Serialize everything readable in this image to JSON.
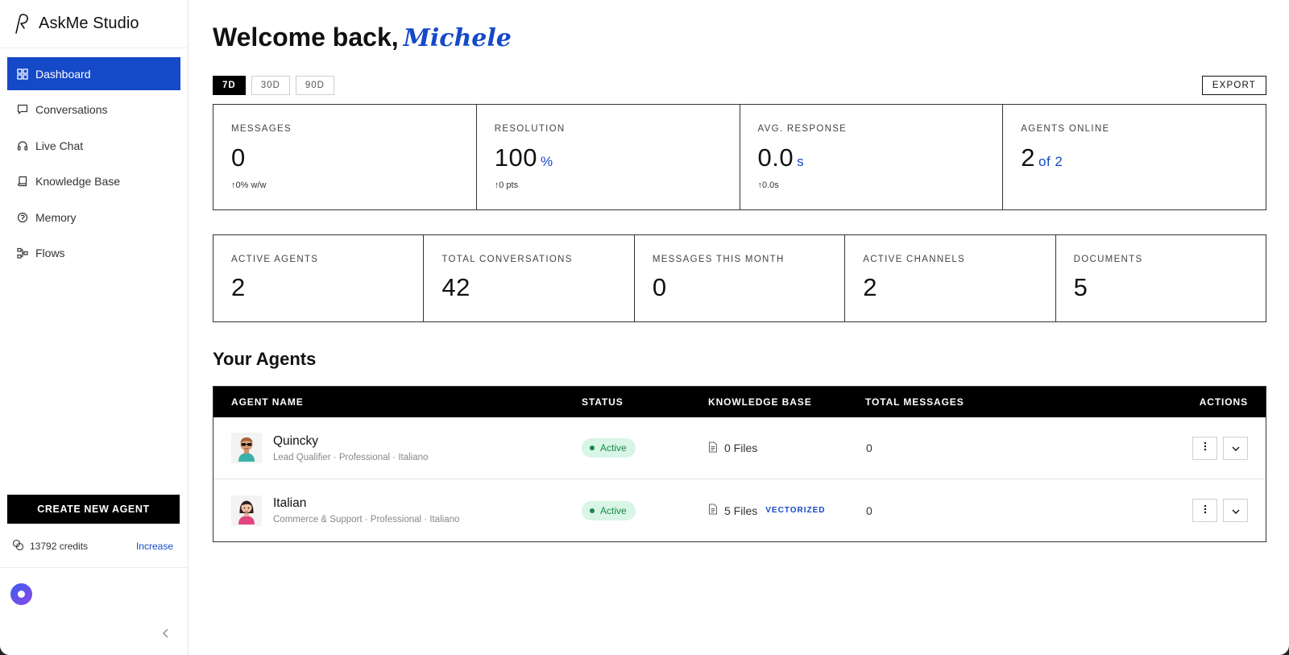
{
  "app": {
    "name": "AskMe Studio"
  },
  "sidebar": {
    "items": [
      {
        "label": "Dashboard",
        "icon": "grid-icon",
        "active": true
      },
      {
        "label": "Conversations",
        "icon": "chat-bubble-icon"
      },
      {
        "label": "Live Chat",
        "icon": "headphones-icon"
      },
      {
        "label": "Knowledge Base",
        "icon": "book-icon"
      },
      {
        "label": "Memory",
        "icon": "memory-icon"
      },
      {
        "label": "Flows",
        "icon": "flow-icon"
      }
    ],
    "create_button": "CREATE NEW AGENT",
    "credits": "13792 credits",
    "increase": "Increase"
  },
  "header": {
    "welcome": "Welcome back,",
    "user_name": "Michele"
  },
  "range_tabs": [
    "7D",
    "30D",
    "90D"
  ],
  "selected_range": "7D",
  "export_label": "EXPORT",
  "stats_primary": [
    {
      "label": "MESSAGES",
      "value": "0",
      "unit": "",
      "delta": "0% w/w"
    },
    {
      "label": "RESOLUTION",
      "value": "100",
      "unit": "%",
      "delta": "0 pts"
    },
    {
      "label": "AVG. RESPONSE",
      "value": "0.0",
      "unit": "s",
      "delta": "0.0s"
    },
    {
      "label": "AGENTS ONLINE",
      "value": "2",
      "unit": "of 2",
      "delta": ""
    }
  ],
  "stats_secondary": [
    {
      "label": "ACTIVE AGENTS",
      "value": "2"
    },
    {
      "label": "TOTAL CONVERSATIONS",
      "value": "42"
    },
    {
      "label": "MESSAGES THIS MONTH",
      "value": "0"
    },
    {
      "label": "ACTIVE CHANNELS",
      "value": "2"
    },
    {
      "label": "DOCUMENTS",
      "value": "5"
    }
  ],
  "agents_section": {
    "title": "Your Agents",
    "columns": {
      "name": "AGENT NAME",
      "status": "STATUS",
      "kb": "KNOWLEDGE BASE",
      "messages": "TOTAL MESSAGES",
      "actions": "ACTIONS"
    },
    "rows": [
      {
        "name": "Quincky",
        "meta": "Lead Qualifier · Professional · Italiano",
        "status": "Active",
        "files": "0 Files",
        "vectorized": "",
        "messages": "0"
      },
      {
        "name": "Italian",
        "meta": "Commerce & Support · Professional · Italiano",
        "status": "Active",
        "files": "5 Files",
        "vectorized": "VECTORIZED",
        "messages": "0"
      }
    ]
  },
  "colors": {
    "accent": "#1549c8",
    "active_badge_bg": "#d9f5e5",
    "active_badge_text": "#178a4c"
  }
}
